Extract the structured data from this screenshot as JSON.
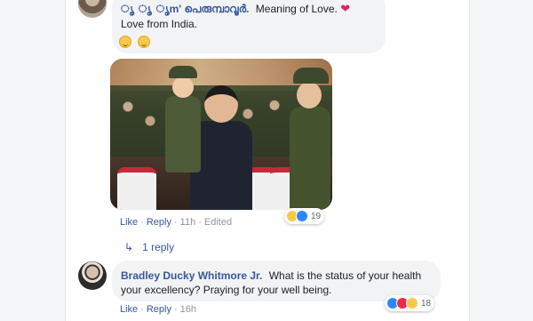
{
  "comment1": {
    "author": "ൃ ൃ ൃm' പെരുമ്പാവൂർ.",
    "text": "Meaning of Love.",
    "heart": "❤",
    "line2": "Love from India.",
    "emoji_icons": [
      "grinning-face-icon",
      "grinning-face-icon"
    ],
    "actions": {
      "like": "Like",
      "reply": "Reply",
      "time": "11h",
      "edited": "Edited"
    },
    "reactions": {
      "icons": [
        "haha",
        "like"
      ],
      "count": "19"
    },
    "replies_link": "1 reply"
  },
  "comment2": {
    "author": "Bradley Ducky Whitmore Jr.",
    "text": "What is the status of your health your excellency? Praying for your well being.",
    "actions": {
      "like": "Like",
      "reply": "Reply",
      "time": "16h"
    },
    "reactions": {
      "icons": [
        "like",
        "love",
        "haha"
      ],
      "count": "18"
    }
  },
  "separator": "·"
}
